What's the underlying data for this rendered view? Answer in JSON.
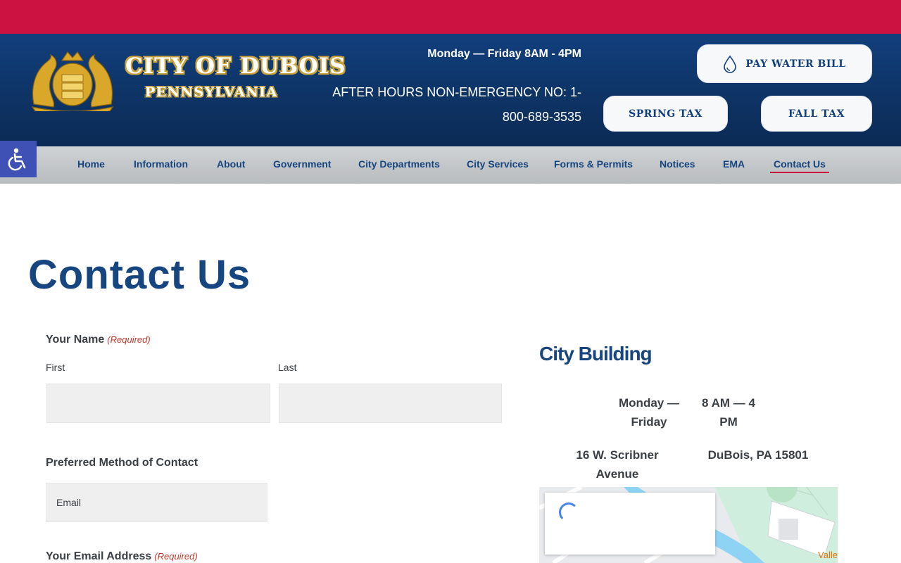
{
  "site": {
    "logo_line1": "CITY OF DUBOIS",
    "logo_line2": "PENNSYLVANIA"
  },
  "header": {
    "hours": "Monday — Friday 8AM - 4PM",
    "after_hours": "AFTER HOURS NON-EMERGENCY NO: 1-800-689-3535",
    "buttons": {
      "water": "PAY WATER BILL",
      "spring": "SPRING TAX",
      "fall": "FALL TAX"
    }
  },
  "nav": {
    "items": [
      {
        "label": "Home"
      },
      {
        "label": "Information"
      },
      {
        "label": "About"
      },
      {
        "label": "Government"
      },
      {
        "label": "City Departments"
      },
      {
        "label": "City Services"
      },
      {
        "label": "Forms & Permits"
      },
      {
        "label": "Notices"
      },
      {
        "label": "EMA"
      },
      {
        "label": "Contact Us",
        "active": true
      }
    ]
  },
  "page": {
    "title": "Contact Us"
  },
  "form": {
    "name_label": "Your Name",
    "required_tag": "(Required)",
    "first_label": "First",
    "last_label": "Last",
    "first_value": "",
    "last_value": "",
    "method_label": "Preferred Method of Contact",
    "method_selected": "Email",
    "email_label": "Your Email Address"
  },
  "sidebar": {
    "title": "City Building",
    "days": "Monday — Friday",
    "time": "8 AM — 4 PM",
    "street": "16 W. Scribner Avenue",
    "city": "DuBois, PA 15801",
    "map_label": "Valle"
  },
  "colors": {
    "brand_red": "#cc1240",
    "brand_blue": "#16457f",
    "header_blue": "#0e3466",
    "accessibility": "#3f51b5"
  }
}
